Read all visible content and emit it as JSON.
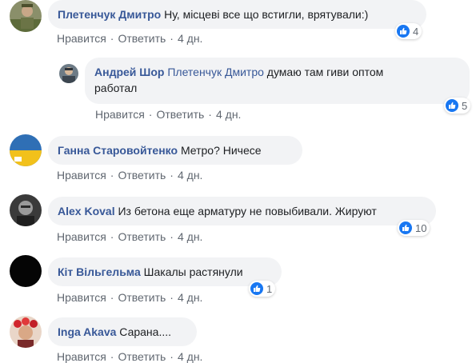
{
  "actions": {
    "like_label": "Нравится",
    "reply_label": "Ответить",
    "separator": "·"
  },
  "comments": [
    {
      "author": "Плетенчук Дмитро",
      "text": "Ну, місцеві все що встигли, врятували:)",
      "time": "4 дн.",
      "reactions": "4"
    },
    {
      "author": "Андрей Шор",
      "mention": "Плетенчук Дмитро",
      "text": "думаю там гиви оптом",
      "text2": "работал",
      "time": "4 дн.",
      "reactions": "5"
    },
    {
      "author": "Ганна Старовойтенко",
      "text": "Метро? Ничесе",
      "time": "4 дн."
    },
    {
      "author": "Alex Koval",
      "text": "Из бетона еще арматуру не повыбивали. Жируют",
      "time": "4 дн.",
      "reactions": "10"
    },
    {
      "author": "Кіт Вільгельма",
      "text": "Шакалы растянули",
      "time": "4 дн.",
      "reactions": "1"
    },
    {
      "author": "Inga Akava",
      "text": "Сарана....",
      "time": "4 дн."
    }
  ],
  "colors": {
    "author": "#385898",
    "bubble": "#f2f3f5",
    "like": "#1877f2",
    "meta": "#606770"
  },
  "icons": {
    "reaction": "like-thumb-icon"
  }
}
